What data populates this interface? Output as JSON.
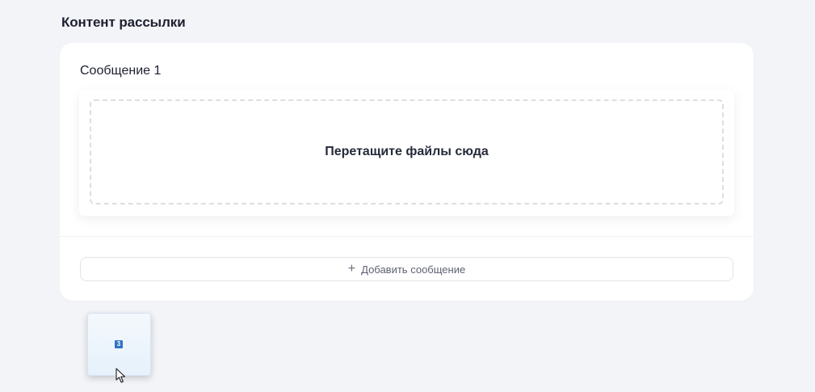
{
  "section": {
    "title": "Контент рассылки"
  },
  "message": {
    "label": "Сообщение 1",
    "dropzone_text": "Перетащите файлы сюда"
  },
  "add_message": {
    "icon": "plus-icon",
    "label": "Добавить сообщение"
  },
  "drag_preview": {
    "icon": "file-icon",
    "glyph": "3"
  },
  "colors": {
    "background": "#f3f4f7",
    "card": "#ffffff",
    "accent": "#2f72c4"
  }
}
